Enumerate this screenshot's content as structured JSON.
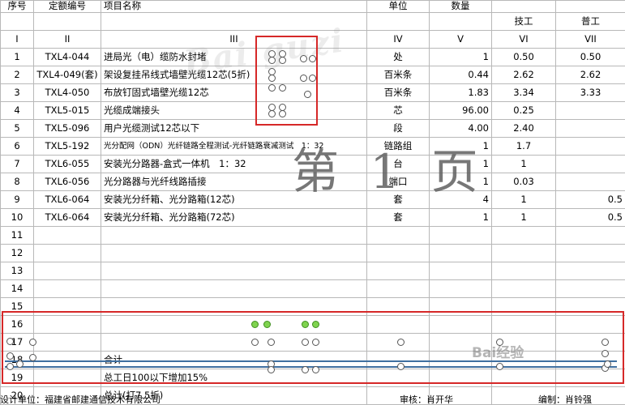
{
  "headers": {
    "seq": "序号",
    "code": "定额编号",
    "name": "项目名称",
    "unit": "单位",
    "qty": "数量",
    "tech": "技工",
    "gen": "普工"
  },
  "roman": [
    "I",
    "II",
    "III",
    "IV",
    "V",
    "VI",
    "VII"
  ],
  "rows": [
    {
      "no": "1",
      "code": "TXL4-044",
      "name": "进局光（电）缆防水封堵",
      "unit": "处",
      "qty": "1",
      "tech": "0.50",
      "gen": "0.50"
    },
    {
      "no": "2",
      "code": "TXL4-049(套)",
      "name": "架设复挂吊线式墙壁光缆12芯(5折)",
      "unit": "百米条",
      "qty": "0.44",
      "tech": "2.62",
      "gen": "2.62"
    },
    {
      "no": "3",
      "code": "TXL4-050",
      "name": "布放钉固式墙壁光缆12芯",
      "unit": "百米条",
      "qty": "1.83",
      "tech": "3.34",
      "gen": "3.33"
    },
    {
      "no": "4",
      "code": "TXL5-015",
      "name": "光缆成端接头",
      "unit": "芯",
      "qty": "96.00",
      "tech": "0.25",
      "gen": ""
    },
    {
      "no": "5",
      "code": "TXL5-096",
      "name": "用户光缆测试12芯以下",
      "unit": "段",
      "qty": "4.00",
      "tech": "2.40",
      "gen": ""
    },
    {
      "no": "6",
      "code": "TXL5-192",
      "name": "光分配网（ODN）光纤链路全程测试-光纤链路衰减测试　1：32",
      "unit": "链路组",
      "qty": "1",
      "tech": "1.7",
      "gen": ""
    },
    {
      "no": "7",
      "code": "TXL6-055",
      "name": "安装光分路器-盒式一体机　1：32",
      "unit": "台",
      "qty": "1",
      "tech": "1",
      "gen": ""
    },
    {
      "no": "8",
      "code": "TXL6-056",
      "name": "光分路器与光纤线路插接",
      "unit": "端口",
      "qty": "1",
      "tech": "0.03",
      "gen": ""
    },
    {
      "no": "9",
      "code": "TXL6-064",
      "name": "安装光分纤箱、光分路箱(12芯)",
      "unit": "套",
      "qty": "4",
      "tech": "1",
      "gen": "0.5"
    },
    {
      "no": "10",
      "code": "TXL6-064",
      "name": "安装光分纤箱、光分路箱(72芯)",
      "unit": "套",
      "qty": "1",
      "tech": "1",
      "gen": "0.5"
    },
    {
      "no": "11",
      "code": "",
      "name": "",
      "unit": "",
      "qty": "",
      "tech": "",
      "gen": ""
    },
    {
      "no": "12",
      "code": "",
      "name": "",
      "unit": "",
      "qty": "",
      "tech": "",
      "gen": ""
    },
    {
      "no": "13",
      "code": "",
      "name": "",
      "unit": "",
      "qty": "",
      "tech": "",
      "gen": ""
    },
    {
      "no": "14",
      "code": "",
      "name": "",
      "unit": "",
      "qty": "",
      "tech": "",
      "gen": ""
    },
    {
      "no": "15",
      "code": "",
      "name": "",
      "unit": "",
      "qty": "",
      "tech": "",
      "gen": ""
    },
    {
      "no": "16",
      "code": "",
      "name": "",
      "unit": "",
      "qty": "",
      "tech": "",
      "gen": ""
    },
    {
      "no": "17",
      "code": "",
      "name": "",
      "unit": "",
      "qty": "",
      "tech": "",
      "gen": ""
    },
    {
      "no": "18",
      "code": "",
      "name": "合计",
      "unit": "",
      "qty": "",
      "tech": "",
      "gen": ""
    },
    {
      "no": "19",
      "code": "",
      "name": "总工日100以下增加15%",
      "unit": "",
      "qty": "",
      "tech": "",
      "gen": ""
    },
    {
      "no": "20",
      "code": "",
      "name": "总计(打7.5折)",
      "unit": "",
      "qty": "",
      "tech": "",
      "gen": ""
    }
  ],
  "overlay": {
    "watermark": "Bai guzi",
    "page_label": "第 1 页",
    "baidu_mark": "Bai经验"
  },
  "footer": {
    "company": "设计单位：福建省邮建通信技术有限公司",
    "reviewer": "审核：肖开华",
    "compiler": "编制：肖铃强"
  },
  "colors": {
    "red_box": "#d62828",
    "selection_line": "#3f6fa0",
    "handle_active": "#7fd34f",
    "grid": "#b8b8b8"
  }
}
